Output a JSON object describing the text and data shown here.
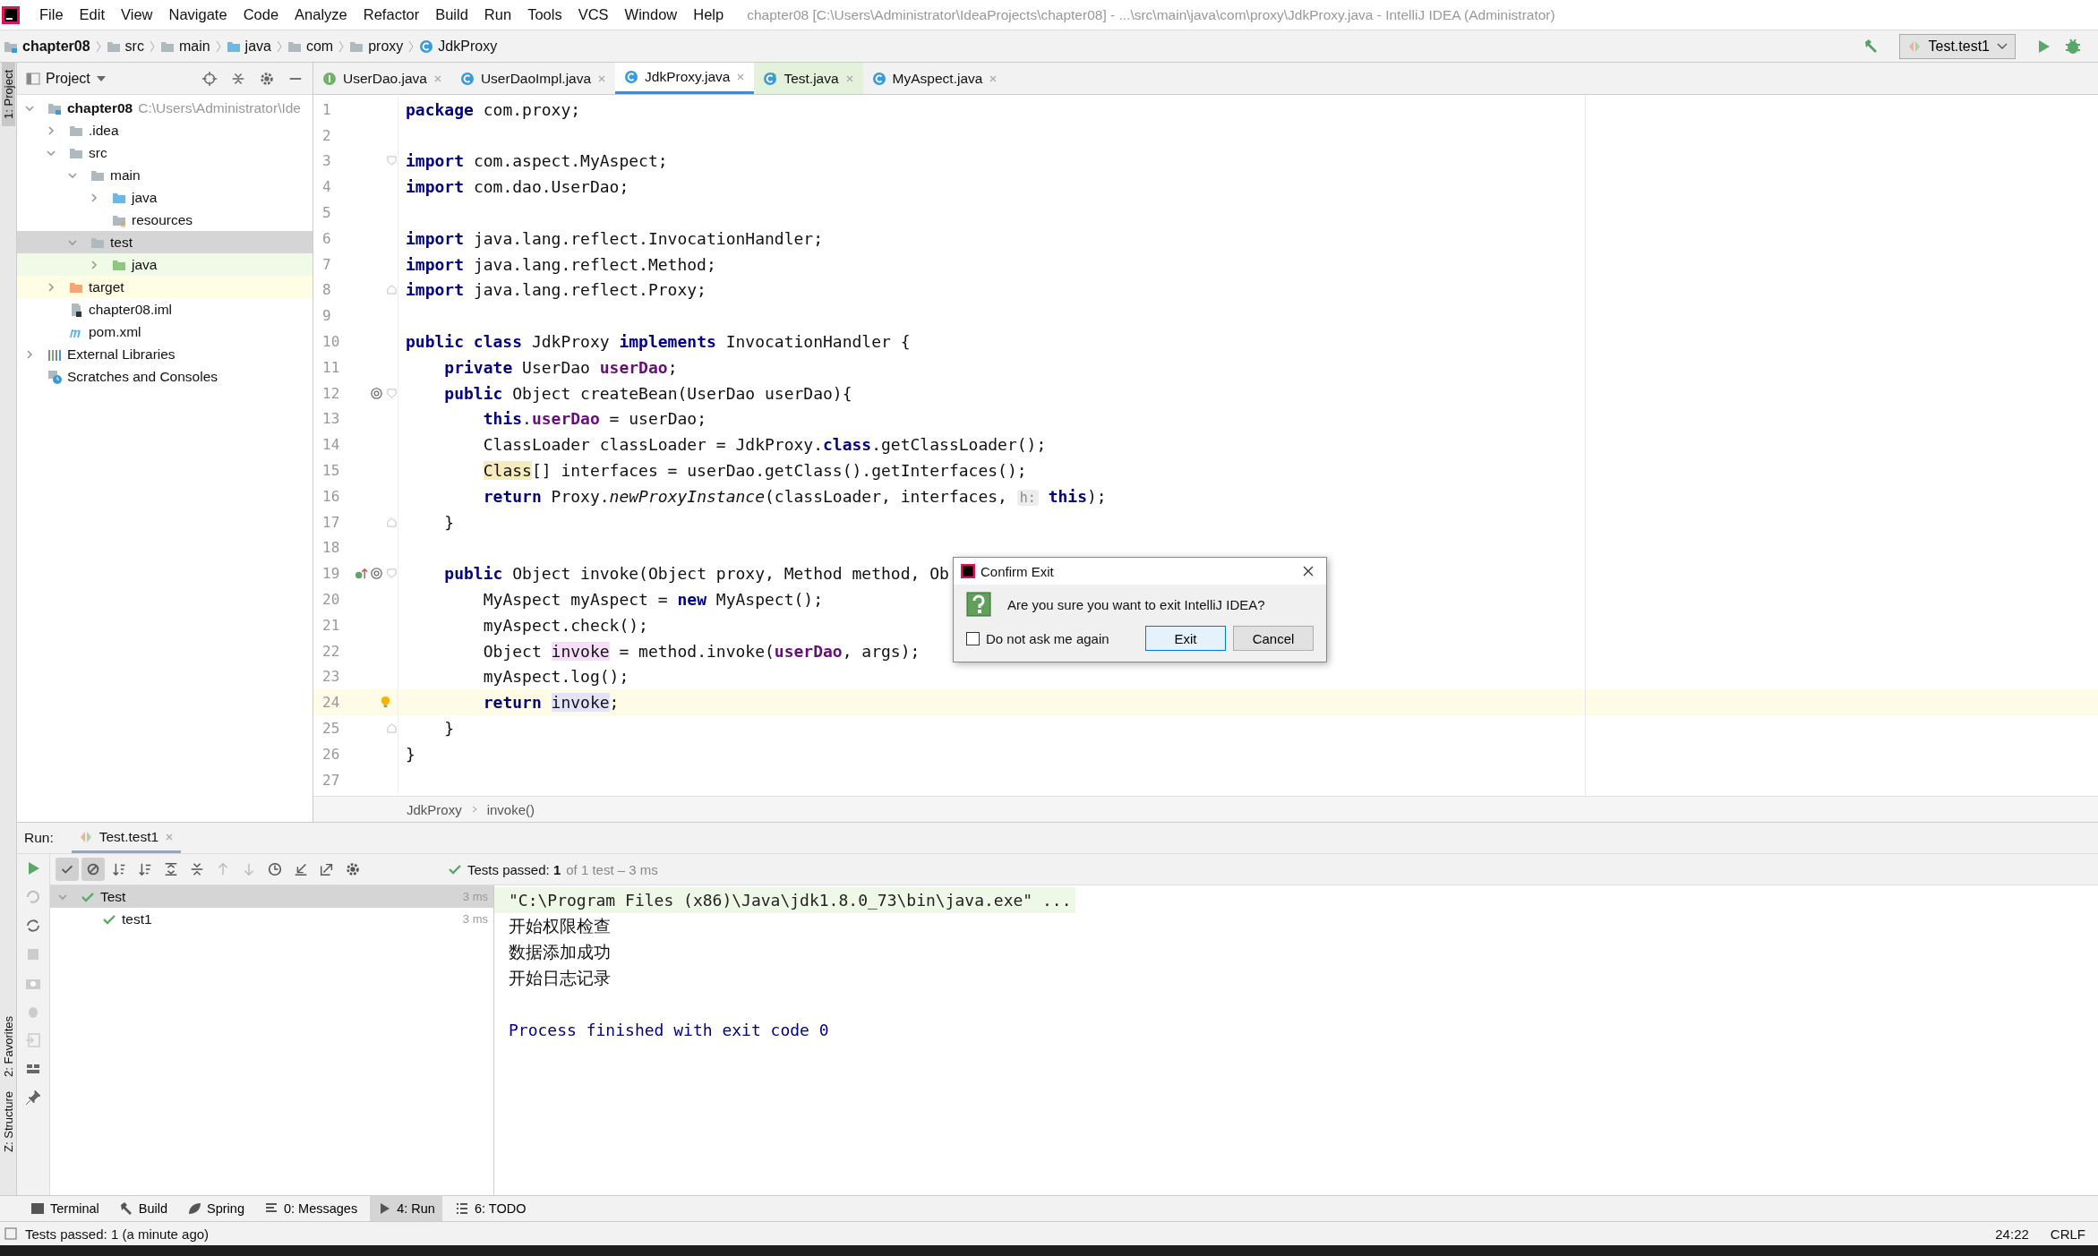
{
  "window": {
    "title": "chapter08 [C:\\Users\\Administrator\\IdeaProjects\\chapter08] - ...\\src\\main\\java\\com\\proxy\\JdkProxy.java - IntelliJ IDEA (Administrator)"
  },
  "menu": [
    "File",
    "Edit",
    "View",
    "Navigate",
    "Code",
    "Analyze",
    "Refactor",
    "Build",
    "Run",
    "Tools",
    "VCS",
    "Window",
    "Help"
  ],
  "nav_path": [
    {
      "label": "chapter08",
      "kind": "module"
    },
    {
      "label": "src",
      "kind": "folder"
    },
    {
      "label": "main",
      "kind": "folder"
    },
    {
      "label": "java",
      "kind": "source-folder"
    },
    {
      "label": "com",
      "kind": "folder"
    },
    {
      "label": "proxy",
      "kind": "folder"
    },
    {
      "label": "JdkProxy",
      "kind": "class"
    }
  ],
  "run_config": {
    "label": "Test.test1"
  },
  "side_stripe": {
    "top": [
      {
        "label": "1: Project",
        "selected": true
      }
    ],
    "bottom": [
      {
        "label": "2: Favorites",
        "selected": false
      },
      {
        "label": "Z: Structure",
        "selected": false
      }
    ]
  },
  "project": {
    "title": "Project",
    "tree": [
      {
        "label": "chapter08",
        "kind": "module",
        "hint": "C:\\Users\\Administrator\\Ide",
        "expanded": true,
        "selected": false,
        "children": [
          {
            "label": ".idea",
            "kind": "folder",
            "expanded": false,
            "selected": false
          },
          {
            "label": "src",
            "kind": "folder",
            "expanded": true,
            "selected": false,
            "children": [
              {
                "label": "main",
                "kind": "folder",
                "expanded": true,
                "selected": false,
                "children": [
                  {
                    "label": "java",
                    "kind": "source-folder",
                    "expanded": false,
                    "selected": false
                  },
                  {
                    "label": "resources",
                    "kind": "resources-folder",
                    "selected": false
                  }
                ]
              },
              {
                "label": "test",
                "kind": "folder",
                "expanded": true,
                "selected": true,
                "children": [
                  {
                    "label": "java",
                    "kind": "test-folder",
                    "expanded": false,
                    "selected": false
                  }
                ]
              }
            ]
          },
          {
            "label": "target",
            "kind": "excluded-folder",
            "expanded": false,
            "selected": false
          },
          {
            "label": "chapter08.iml",
            "kind": "iml-file",
            "selected": false
          },
          {
            "label": "pom.xml",
            "kind": "maven-file",
            "selected": false
          }
        ]
      },
      {
        "label": "External Libraries",
        "kind": "libraries",
        "expanded": false,
        "selected": false
      },
      {
        "label": "Scratches and Consoles",
        "kind": "scratches",
        "selected": false
      }
    ]
  },
  "editor": {
    "tabs": [
      {
        "label": "UserDao.java",
        "kind": "interface",
        "selected": false
      },
      {
        "label": "UserDaoImpl.java",
        "kind": "class",
        "selected": false
      },
      {
        "label": "JdkProxy.java",
        "kind": "class",
        "selected": true
      },
      {
        "label": "Test.java",
        "kind": "test-class",
        "selected": false
      },
      {
        "label": "MyAspect.java",
        "kind": "class",
        "selected": false
      }
    ],
    "lines": [
      {
        "number": "1",
        "segments": [
          {
            "text": "package",
            "kind": "keyword"
          },
          {
            "text": " com.proxy;",
            "kind": "plain"
          }
        ]
      },
      {
        "number": "2"
      },
      {
        "number": "3",
        "fold_start": true,
        "segments": [
          {
            "text": "import",
            "kind": "keyword"
          },
          {
            "text": " com.aspect.MyAspect;",
            "kind": "plain"
          }
        ]
      },
      {
        "number": "4",
        "segments": [
          {
            "text": "import",
            "kind": "keyword"
          },
          {
            "text": " com.dao.UserDao;",
            "kind": "plain"
          }
        ]
      },
      {
        "number": "5"
      },
      {
        "number": "6",
        "segments": [
          {
            "text": "import",
            "kind": "keyword"
          },
          {
            "text": " java.lang.reflect.InvocationHandler;",
            "kind": "plain"
          }
        ]
      },
      {
        "number": "7",
        "segments": [
          {
            "text": "import",
            "kind": "keyword"
          },
          {
            "text": " java.lang.reflect.Method;",
            "kind": "plain"
          }
        ]
      },
      {
        "number": "8",
        "fold_end": true,
        "segments": [
          {
            "text": "import",
            "kind": "keyword"
          },
          {
            "text": " java.lang.reflect.Proxy;",
            "kind": "plain"
          }
        ]
      },
      {
        "number": "9"
      },
      {
        "number": "10",
        "segments": [
          {
            "text": "public class",
            "kind": "keyword"
          },
          {
            "text": " JdkProxy ",
            "kind": "plain"
          },
          {
            "text": "implements",
            "kind": "keyword"
          },
          {
            "text": " InvocationHandler {",
            "kind": "plain"
          }
        ]
      },
      {
        "number": "11",
        "segments": [
          {
            "text": "    private",
            "kind": "keyword"
          },
          {
            "text": " UserDao ",
            "kind": "plain"
          },
          {
            "text": "userDao",
            "kind": "field"
          },
          {
            "text": ";",
            "kind": "plain"
          }
        ]
      },
      {
        "number": "12",
        "annotated": true,
        "fold_start": true,
        "segments": [
          {
            "text": "    public",
            "kind": "keyword"
          },
          {
            "text": " Object createBean(UserDao userDao){",
            "kind": "plain"
          }
        ]
      },
      {
        "number": "13",
        "segments": [
          {
            "text": "        this",
            "kind": "keyword"
          },
          {
            "text": ".",
            "kind": "plain"
          },
          {
            "text": "userDao",
            "kind": "field"
          },
          {
            "text": " = userDao;",
            "kind": "plain"
          }
        ]
      },
      {
        "number": "14",
        "segments": [
          {
            "text": "        ClassLoader classLoader = JdkProxy.",
            "kind": "plain"
          },
          {
            "text": "class",
            "kind": "keyword"
          },
          {
            "text": ".getClassLoader();",
            "kind": "plain"
          }
        ]
      },
      {
        "number": "15",
        "segments": [
          {
            "text": "        Class",
            "kind": "warning"
          },
          {
            "text": "[] interfaces = userDao.getClass().getInterfaces();",
            "kind": "plain"
          }
        ]
      },
      {
        "number": "16",
        "segments": [
          {
            "text": "        return",
            "kind": "keyword"
          },
          {
            "text": " Proxy.",
            "kind": "plain"
          },
          {
            "text": "newProxyInstance",
            "kind": "italic"
          },
          {
            "text": "(classLoader, interfaces, ",
            "kind": "plain"
          },
          {
            "text": "h:",
            "kind": "hint"
          },
          {
            "text": " this",
            "kind": "keyword"
          },
          {
            "text": ");",
            "kind": "plain"
          }
        ]
      },
      {
        "number": "17",
        "fold_end": true,
        "segments": [
          {
            "text": "    }",
            "kind": "plain"
          }
        ]
      },
      {
        "number": "18"
      },
      {
        "number": "19",
        "implements": true,
        "annotated": true,
        "fold_start": true,
        "segments": [
          {
            "text": "    public",
            "kind": "keyword"
          },
          {
            "text": " Object invoke(Object proxy, Method method, Ob",
            "kind": "plain"
          }
        ]
      },
      {
        "number": "20",
        "segments": [
          {
            "text": "        MyAspect myAspect = ",
            "kind": "plain"
          },
          {
            "text": "new",
            "kind": "keyword"
          },
          {
            "text": " MyAspect();",
            "kind": "plain"
          }
        ]
      },
      {
        "number": "21",
        "segments": [
          {
            "text": "        myAspect.check();",
            "kind": "plain"
          }
        ]
      },
      {
        "number": "22",
        "segments": [
          {
            "text": "        Object ",
            "kind": "plain"
          },
          {
            "text": "invoke",
            "kind": "usage-write"
          },
          {
            "text": " = method.invoke(",
            "kind": "plain"
          },
          {
            "text": "userDao",
            "kind": "field"
          },
          {
            "text": ", args);",
            "kind": "plain"
          }
        ]
      },
      {
        "number": "23",
        "segments": [
          {
            "text": "        myAspect.log();",
            "kind": "plain"
          }
        ]
      },
      {
        "number": "24",
        "current": true,
        "intention_bulb": true,
        "segments": [
          {
            "text": "        return",
            "kind": "keyword"
          },
          {
            "text": " invoke",
            "kind": "usage-read"
          },
          {
            "text": ";",
            "kind": "plain"
          }
        ]
      },
      {
        "number": "25",
        "fold_end": true,
        "segments": [
          {
            "text": "    }",
            "kind": "plain"
          }
        ]
      },
      {
        "number": "26",
        "segments": [
          {
            "text": "}",
            "kind": "plain"
          }
        ]
      },
      {
        "number": "27"
      }
    ],
    "breadcrumb": [
      "JdkProxy",
      "invoke()"
    ]
  },
  "dialog": {
    "title": "Confirm Exit",
    "message": "Are you sure you want to exit IntelliJ IDEA?",
    "checkbox": {
      "label": "Do not ask me again",
      "checked": false
    },
    "buttons": [
      {
        "label": "Exit",
        "default": true
      },
      {
        "label": "Cancel",
        "default": false
      }
    ]
  },
  "run": {
    "label": "Run:",
    "tab": "Test.test1",
    "filters": [
      {
        "kind": "passed",
        "on": true
      },
      {
        "kind": "ignored",
        "on": true
      }
    ],
    "status": "Tests passed: **1**",
    "status_detail": "of 1 test – 3 ms",
    "tree": [
      {
        "label": "Test",
        "time": "3 ms",
        "expanded": true,
        "selected": true,
        "children": [
          {
            "label": "test1",
            "time": "3 ms",
            "selected": false
          }
        ]
      }
    ],
    "console": [
      {
        "text": "\"C:\\Program Files (x86)\\Java\\jdk1.8.0_73\\bin\\java.exe\" ...",
        "kind": "command"
      },
      {
        "text": "开始权限检查",
        "kind": "output"
      },
      {
        "text": "数据添加成功",
        "kind": "output"
      },
      {
        "text": "开始日志记录",
        "kind": "output"
      },
      {
        "text": "Process finished with exit code 0",
        "kind": "system"
      }
    ]
  },
  "tool_windows": [
    {
      "label": "Terminal",
      "kind": "terminal",
      "selected": false
    },
    {
      "label": "Build",
      "kind": "build",
      "selected": false
    },
    {
      "label": "Spring",
      "kind": "spring",
      "selected": false
    },
    {
      "label": "0: Messages",
      "kind": "messages",
      "selected": false
    },
    {
      "label": "4: Run",
      "kind": "run",
      "selected": true
    },
    {
      "label": "6: TODO",
      "kind": "todo",
      "selected": false
    }
  ],
  "status_bar": {
    "message": "Tests passed: 1 (a minute ago)",
    "position": "24:22",
    "line_separator": "CRLF"
  }
}
